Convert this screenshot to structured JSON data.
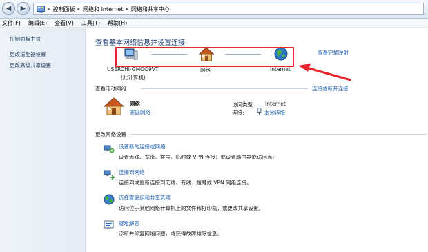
{
  "address_bar": {
    "breadcrumbs": [
      "控制面板",
      "网络和 Internet",
      "网络和共享中心"
    ],
    "icons": {
      "back": "back-arrow-icon",
      "forward": "forward-arrow-icon",
      "location": "control-panel-icon"
    }
  },
  "menu": {
    "items": [
      "文件(F)",
      "编辑(E)",
      "查看(V)",
      "工具(T)",
      "帮助(H)"
    ]
  },
  "sidebar": {
    "items": [
      "控制面板主页",
      "更改适配器设置",
      "更改高级共享设置"
    ]
  },
  "main": {
    "title": "查看基本网络信息并设置连接",
    "view_full_map": "查看完整映射",
    "network_map": {
      "computer": "USERCHI-GMOO9VT",
      "computer_sub": "(此计算机)",
      "network": "网络",
      "internet": "Internet"
    },
    "active_networks": {
      "heading": "查看活动网络",
      "connect_disconnect": "连接或断开连接",
      "network_name": "网络",
      "network_type": "家庭网络",
      "access_type_label": "访问类型:",
      "access_type_value": "Internet",
      "connections_label": "连接:",
      "connections_value": "本地连接"
    },
    "change_settings": {
      "heading": "更改网络设置",
      "tasks": [
        {
          "title": "设置新的连接或网络",
          "desc": "设置无线、宽带、拨号、临时或 VPN 连接；或设置路由器或访问点。",
          "icon": "new-connection-icon"
        },
        {
          "title": "连接到网络",
          "desc": "连接到或重新连接到无线、有线、拨号或 VPN 网络连接。",
          "icon": "connect-network-icon"
        },
        {
          "title": "选择家庭组和共享选项",
          "desc": "访问位于其他网络计算机上的文件和打印机，或更改共享设置。",
          "icon": "homegroup-icon"
        },
        {
          "title": "疑难解答",
          "desc": "诊断并修复网络问题，或获得故障排除信息。",
          "icon": "troubleshoot-icon"
        }
      ]
    }
  },
  "colors": {
    "link": "#2264b5",
    "title": "#1e3f7a",
    "highlight": "#e8232b"
  }
}
